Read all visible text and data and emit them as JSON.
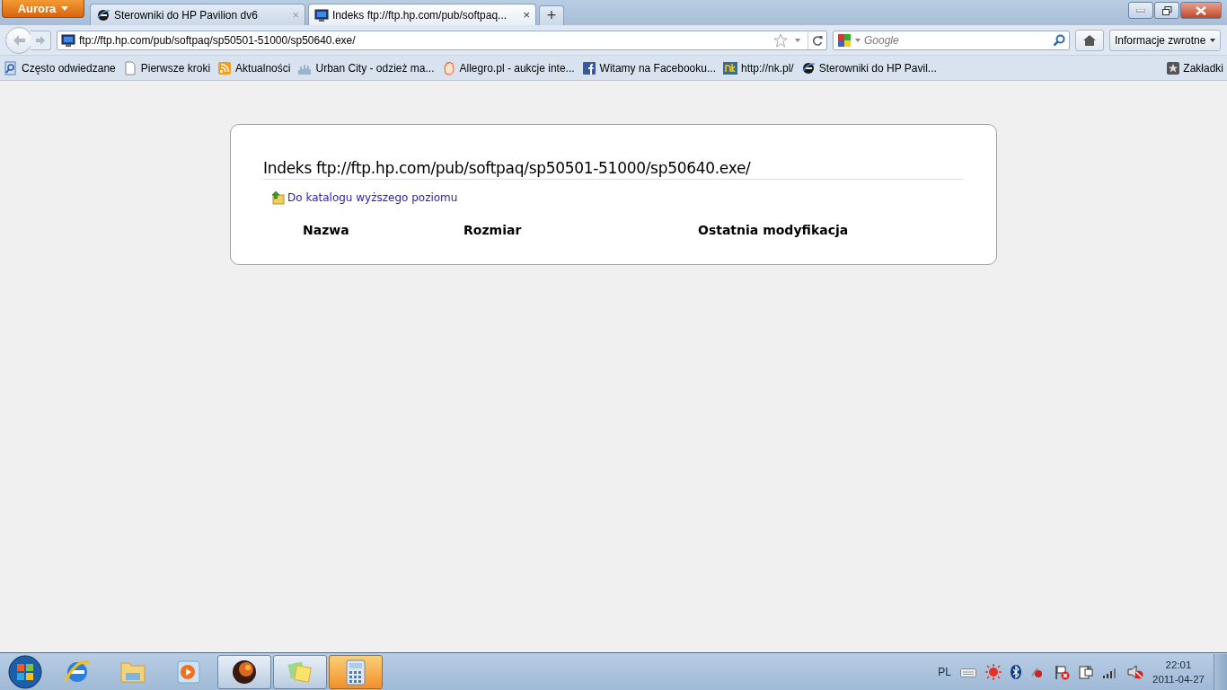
{
  "app_button": "Aurora",
  "tabs": [
    {
      "label": "Sterowniki do HP Pavilion dv6",
      "kind": "ie",
      "close": "×",
      "selected": false
    },
    {
      "label": "Indeks ftp://ftp.hp.com/pub/softpaq...",
      "kind": "monitor",
      "close": "×",
      "selected": true
    }
  ],
  "new_tab_button": "+",
  "address": {
    "value": "ftp://ftp.hp.com/pub/softpaq/sp50501-51000/sp50640.exe/"
  },
  "search": {
    "placeholder": "Google"
  },
  "feedback_button": "Informacje zwrotne",
  "bookmarks": [
    {
      "label": "Często odwiedzane",
      "kind": "search"
    },
    {
      "label": "Pierwsze kroki",
      "kind": "page"
    },
    {
      "label": "Aktualności",
      "kind": "rss"
    },
    {
      "label": "Urban City - odzież ma...",
      "kind": "chart"
    },
    {
      "label": "Allegro.pl - aukcje inte...",
      "kind": "hand"
    },
    {
      "label": "Witamy na Facebooku...",
      "kind": "facebook"
    },
    {
      "label": "http://nk.pl/",
      "kind": "nk"
    },
    {
      "label": "Sterowniki do HP Pavil...",
      "kind": "ie"
    }
  ],
  "bookmarks_menu": "Zakładki",
  "listing": {
    "title": "Indeks ftp://ftp.hp.com/pub/softpaq/sp50501-51000/sp50640.exe/",
    "parent_link": "Do katalogu wyższego poziomu",
    "columns": [
      "Nazwa",
      "Rozmiar",
      "Ostatnia modyfikacja"
    ]
  },
  "taskbar": {
    "apps": [
      {
        "kind": "ie",
        "open": false,
        "highlighted": false
      },
      {
        "kind": "folder",
        "open": false,
        "highlighted": false
      },
      {
        "kind": "player",
        "open": false,
        "highlighted": false
      },
      {
        "kind": "globe",
        "open": true,
        "highlighted": false
      },
      {
        "kind": "notes",
        "open": true,
        "highlighted": false
      },
      {
        "kind": "calculator",
        "open": true,
        "highlighted": true
      }
    ],
    "language": "PL",
    "time": "22:01",
    "date": "2011-04-27"
  }
}
